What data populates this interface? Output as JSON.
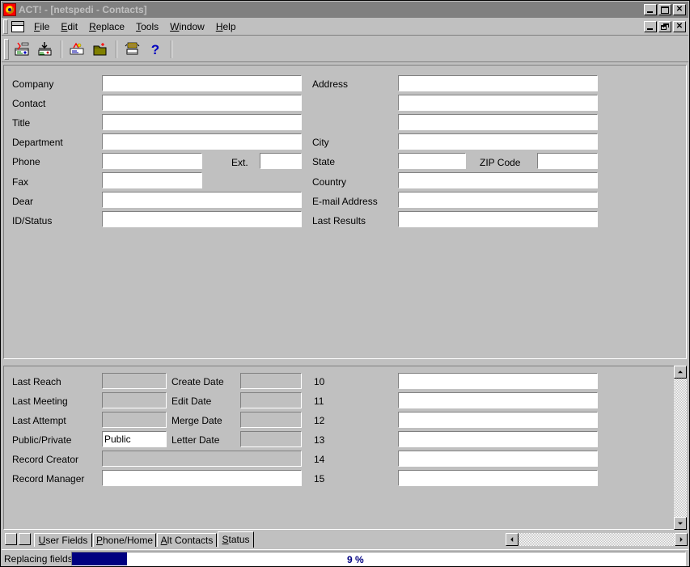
{
  "window": {
    "title": "ACT! - [netspedi - Contacts]",
    "app_icon": "act-app-icon",
    "controls": {
      "minimize": "_",
      "maximize": "□",
      "close": "✕"
    }
  },
  "mdi_controls": {
    "minimize": "_",
    "restore": "❐",
    "close": "✕"
  },
  "menu": {
    "doc_icon": "document-icon",
    "items": [
      {
        "label": "File",
        "accel": "F"
      },
      {
        "label": "Edit",
        "accel": "E"
      },
      {
        "label": "Replace",
        "accel": "R"
      },
      {
        "label": "Tools",
        "accel": "T"
      },
      {
        "label": "Window",
        "accel": "W"
      },
      {
        "label": "Help",
        "accel": "H"
      }
    ]
  },
  "toolbar": {
    "buttons": [
      {
        "name": "new-contact-button",
        "icon": "contact-card-new-icon"
      },
      {
        "name": "insert-note-button",
        "icon": "contact-card-insert-icon"
      },
      {
        "name": "lookup-button",
        "icon": "lookup-contact-icon"
      },
      {
        "name": "open-database-button",
        "icon": "open-folder-icon"
      },
      {
        "name": "dial-modem-button",
        "icon": "modem-dial-icon"
      },
      {
        "name": "help-button",
        "icon": "question-mark-icon",
        "glyph": "?"
      }
    ]
  },
  "contact_form": {
    "left_fields": [
      {
        "label": "Company",
        "value": ""
      },
      {
        "label": "Contact",
        "value": ""
      },
      {
        "label": "Title",
        "value": ""
      },
      {
        "label": "Department",
        "value": ""
      },
      {
        "label": "Phone",
        "value": ""
      },
      {
        "label": "Fax",
        "value": ""
      },
      {
        "label": "Dear",
        "value": ""
      },
      {
        "label": "ID/Status",
        "value": ""
      }
    ],
    "ext_label": "Ext.",
    "ext_value": "",
    "right_fields": [
      {
        "label": "Address",
        "value": ""
      },
      {
        "label": "",
        "value": ""
      },
      {
        "label": "",
        "value": ""
      },
      {
        "label": "City",
        "value": ""
      },
      {
        "label": "State",
        "value": ""
      },
      {
        "label": "Country",
        "value": ""
      },
      {
        "label": "E-mail Address",
        "value": ""
      },
      {
        "label": "Last Results",
        "value": ""
      }
    ],
    "zip_label": "ZIP Code",
    "zip_value": ""
  },
  "status_tab": {
    "left_fields": [
      {
        "label": "Last Reach",
        "value": "",
        "readonly": true
      },
      {
        "label": "Last Meeting",
        "value": "",
        "readonly": true
      },
      {
        "label": "Last Attempt",
        "value": "",
        "readonly": true
      },
      {
        "label": "Public/Private",
        "value": "Public",
        "readonly": false
      },
      {
        "label": "Record Creator",
        "value": "",
        "readonly": true
      },
      {
        "label": "Record Manager",
        "value": "",
        "readonly": false
      }
    ],
    "mid_fields": [
      {
        "label": "Create Date",
        "value": "",
        "readonly": true
      },
      {
        "label": "Edit Date",
        "value": "",
        "readonly": true
      },
      {
        "label": "Merge Date",
        "value": "",
        "readonly": true
      },
      {
        "label": "Letter Date",
        "value": "",
        "readonly": true
      }
    ],
    "user_fields": [
      {
        "label": "10",
        "value": ""
      },
      {
        "label": "11",
        "value": ""
      },
      {
        "label": "12",
        "value": ""
      },
      {
        "label": "13",
        "value": ""
      },
      {
        "label": "14",
        "value": ""
      },
      {
        "label": "15",
        "value": ""
      }
    ]
  },
  "tabs": {
    "prev_label": "◄",
    "next_label": "►",
    "items": [
      {
        "label": "User Fields",
        "accel": "U",
        "active": false
      },
      {
        "label": "Phone/Home",
        "accel": "P",
        "active": false
      },
      {
        "label": "Alt Contacts",
        "accel": "A",
        "active": false
      },
      {
        "label": "Status",
        "accel": "S",
        "active": true
      }
    ]
  },
  "statusbar": {
    "message": "Replacing fields",
    "percent_label": "9 %",
    "percent_value": 9,
    "bar_color": "#000080"
  }
}
